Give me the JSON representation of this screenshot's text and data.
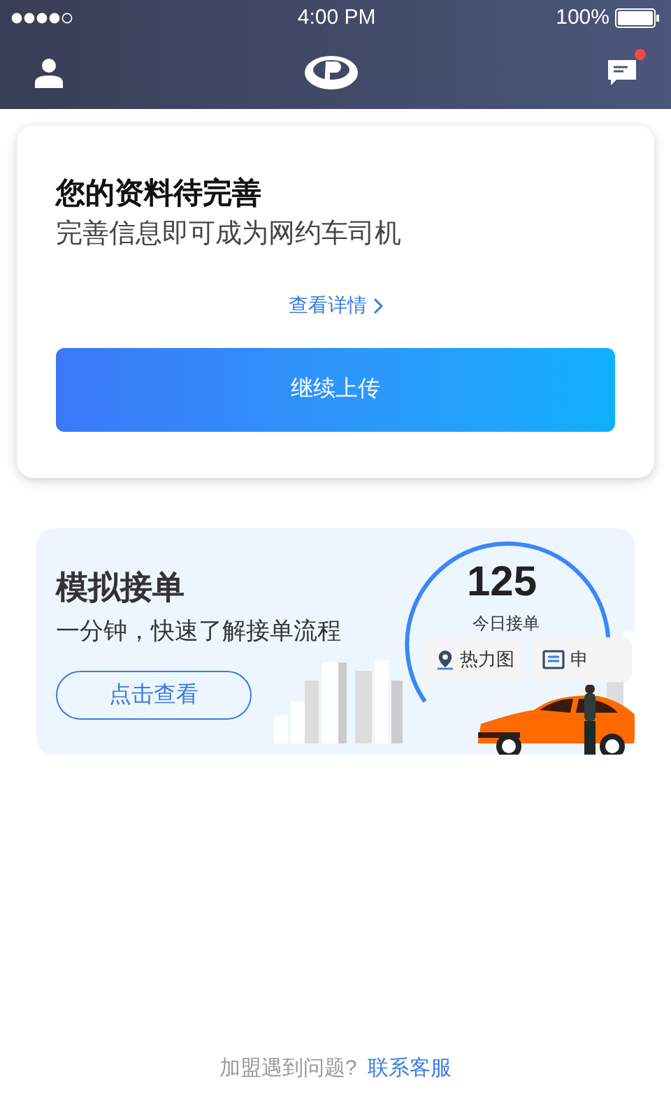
{
  "status_bar": {
    "time": "4:00 PM",
    "battery": "100%"
  },
  "nav_bar": {
    "messages_unread": true
  },
  "profile_card": {
    "title": "您的资料待完善",
    "subtitle": "完善信息即可成为网约车司机",
    "link": "查看详情",
    "button": "继续上传"
  },
  "simulation_card": {
    "title": "模拟接单",
    "subtitle": "一分钟，快速了解接单流程",
    "button": "点击查看",
    "illustration": {
      "count": "125",
      "count_label": "今日接单",
      "chips": [
        {
          "label": "热力图",
          "kind": "map"
        },
        {
          "label": "申",
          "kind": "message"
        }
      ]
    }
  },
  "footer": {
    "question": "加盟遇到问题?",
    "link": "联系客服"
  }
}
